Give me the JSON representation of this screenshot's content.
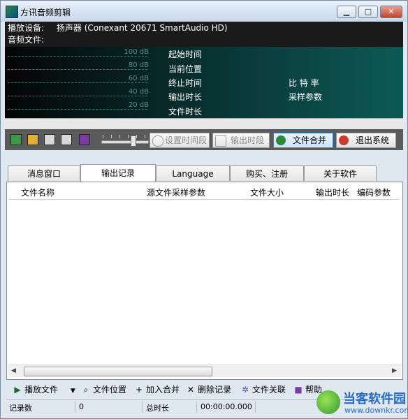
{
  "window": {
    "title": "方讯音频剪辑",
    "min": "▁",
    "max": "□",
    "close": "✕"
  },
  "info": {
    "device_label": "播放设备:",
    "device_value": "扬声器 (Conexant 20671 SmartAudio HD)",
    "file_label": "音频文件:",
    "file_value": ""
  },
  "meter": {
    "db": [
      "100 dB",
      "80 dB",
      "60 dB",
      "40 dB",
      "20 dB"
    ]
  },
  "fields": {
    "start": "起始时间",
    "current": "当前位置",
    "end": "终止时间",
    "out_len": "输出时长",
    "file_len": "文件时长",
    "bitrate": "比 特 率",
    "sampling": "采样参数"
  },
  "toolbar": {
    "icons": [
      "monitor-icon",
      "folder-icon",
      "play-icon",
      "stop-icon",
      "book-icon"
    ],
    "volume": 0.7,
    "set_range": "设置时间段",
    "output_range": "输出时段",
    "merge": "文件合并",
    "exit": "退出系统"
  },
  "tabs": [
    "消息窗口",
    "输出记录",
    "Language",
    "购买、注册",
    "关于软件"
  ],
  "selected_tab": "输出记录",
  "table": {
    "columns": [
      "文件名称",
      "源文件采样参数",
      "文件大小",
      "输出时长",
      "编码参数"
    ],
    "rows": []
  },
  "actions": {
    "play": "播放文件",
    "locate": "文件位置",
    "add_merge": "加入合并",
    "delete": "删除记录",
    "assoc": "文件关联",
    "help": "帮助"
  },
  "status": {
    "count_label": "记录数",
    "count_value": "0",
    "total_label": "总时长",
    "total_value": "00:00:00.000"
  },
  "watermark": {
    "name": "当客软件园",
    "url": "www.downkr.com"
  }
}
